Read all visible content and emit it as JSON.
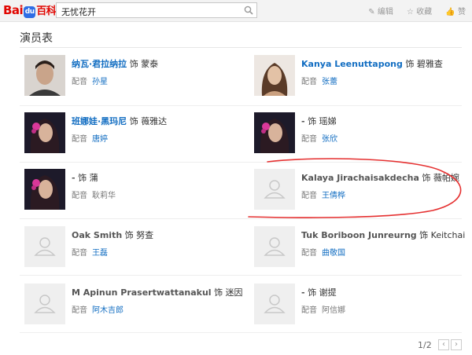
{
  "logo": {
    "part1": "Bai",
    "paw": "du",
    "part2": "百科"
  },
  "search": {
    "value": "无忧花开",
    "icon": "search-icon"
  },
  "actions": [
    {
      "icon": "pencil-icon",
      "label": "编辑"
    },
    {
      "icon": "star-icon",
      "label": "收藏"
    },
    {
      "icon": "thumbs-up-icon",
      "label": "赞"
    }
  ],
  "section": {
    "title": "演员表"
  },
  "cast": [
    {
      "actor": "纳瓦·君拉纳拉",
      "role_prefix": "饰",
      "role": "蒙泰",
      "voice_label": "配音",
      "voice": "孙星",
      "photo": "man"
    },
    {
      "actor": "Kanya Leenuttapong",
      "role_prefix": "饰",
      "role": "碧雅查",
      "voice_label": "配音",
      "voice": "张蕾",
      "photo": "woman-curly"
    },
    {
      "actor": "班娜娃·黑玛尼",
      "role_prefix": "饰",
      "role": "薇雅达",
      "voice_label": "配音",
      "voice": "唐婷",
      "photo": "woman-flower"
    },
    {
      "actor": "-",
      "role_prefix": "饰",
      "role": "瑶娣",
      "voice_label": "配音",
      "voice": "张欣",
      "photo": "woman-flower"
    },
    {
      "actor": "-",
      "role_prefix": "饰",
      "role": "蒲",
      "voice_label": "配音",
      "voice": "耿莉华",
      "photo": "woman-flower"
    },
    {
      "actor": "Kalaya Jirachaisakdecha",
      "role_prefix": "饰",
      "role": "薇帕婉",
      "voice_label": "配音",
      "voice": "王倩桦",
      "photo": "placeholder"
    },
    {
      "actor": "Oak Smith",
      "role_prefix": "饰",
      "role": "努查",
      "voice_label": "配音",
      "voice": "王磊",
      "photo": "placeholder"
    },
    {
      "actor": "Tuk Boriboon Junreurng",
      "role_prefix": "饰",
      "role": "Keitchai",
      "voice_label": "配音",
      "voice": "曲敬国",
      "photo": "placeholder"
    },
    {
      "actor": "M Apinun Prasertwattanakul",
      "role_prefix": "饰",
      "role": "迷因",
      "voice_label": "配音",
      "voice": "阿木吉郎",
      "photo": "placeholder"
    },
    {
      "actor": "-",
      "role_prefix": "饰",
      "role": "谢提",
      "voice_label": "配音",
      "voice": "阿信娜",
      "photo": "placeholder"
    }
  ],
  "pagination": {
    "text": "1/2",
    "prev": "‹",
    "next": "›"
  }
}
